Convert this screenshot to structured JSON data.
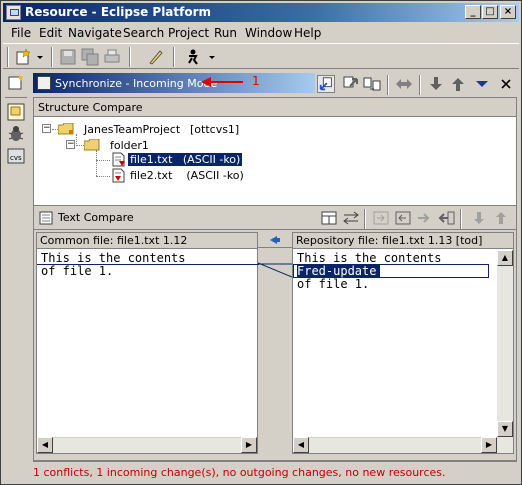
{
  "window": {
    "title": "Resource - Eclipse Platform",
    "buttons": {
      "minimize": "_",
      "maximize": "□",
      "close": "×"
    }
  },
  "menu": [
    "File",
    "Edit",
    "Navigate",
    "Search",
    "Project",
    "Run",
    "Window",
    "Help"
  ],
  "synchronize_view": {
    "title": "Synchronize - Incoming Mode",
    "callout_number": "1",
    "structure_compare": {
      "header": "Structure Compare",
      "project": {
        "name": "JanesTeamProject",
        "tag": "[ottcvs1]"
      },
      "folder": "folder1",
      "files": [
        {
          "name": "file1.txt",
          "mode": "(ASCII -ko)",
          "selected": true,
          "status": "conflict"
        },
        {
          "name": "file2.txt",
          "mode": "(ASCII -ko)",
          "selected": false,
          "status": "incoming"
        }
      ]
    },
    "text_compare": {
      "header": "Text Compare",
      "left": {
        "header": "Common file: file1.txt 1.12",
        "lines": [
          "This is the contents",
          "of file 1."
        ]
      },
      "right": {
        "header": "Repository file: file1.txt 1.13 [tod]",
        "lines": [
          "This is the contents",
          "Fred-update",
          "of file 1."
        ],
        "highlighted_line": "Fred-update"
      }
    },
    "status": "1 conflicts, 1 incoming change(s), no outgoing changes, no new resources."
  },
  "colors": {
    "accent": "#0a246a",
    "status_text": "#c00000",
    "selection": "#0a246a",
    "arrow": "#e00000"
  }
}
